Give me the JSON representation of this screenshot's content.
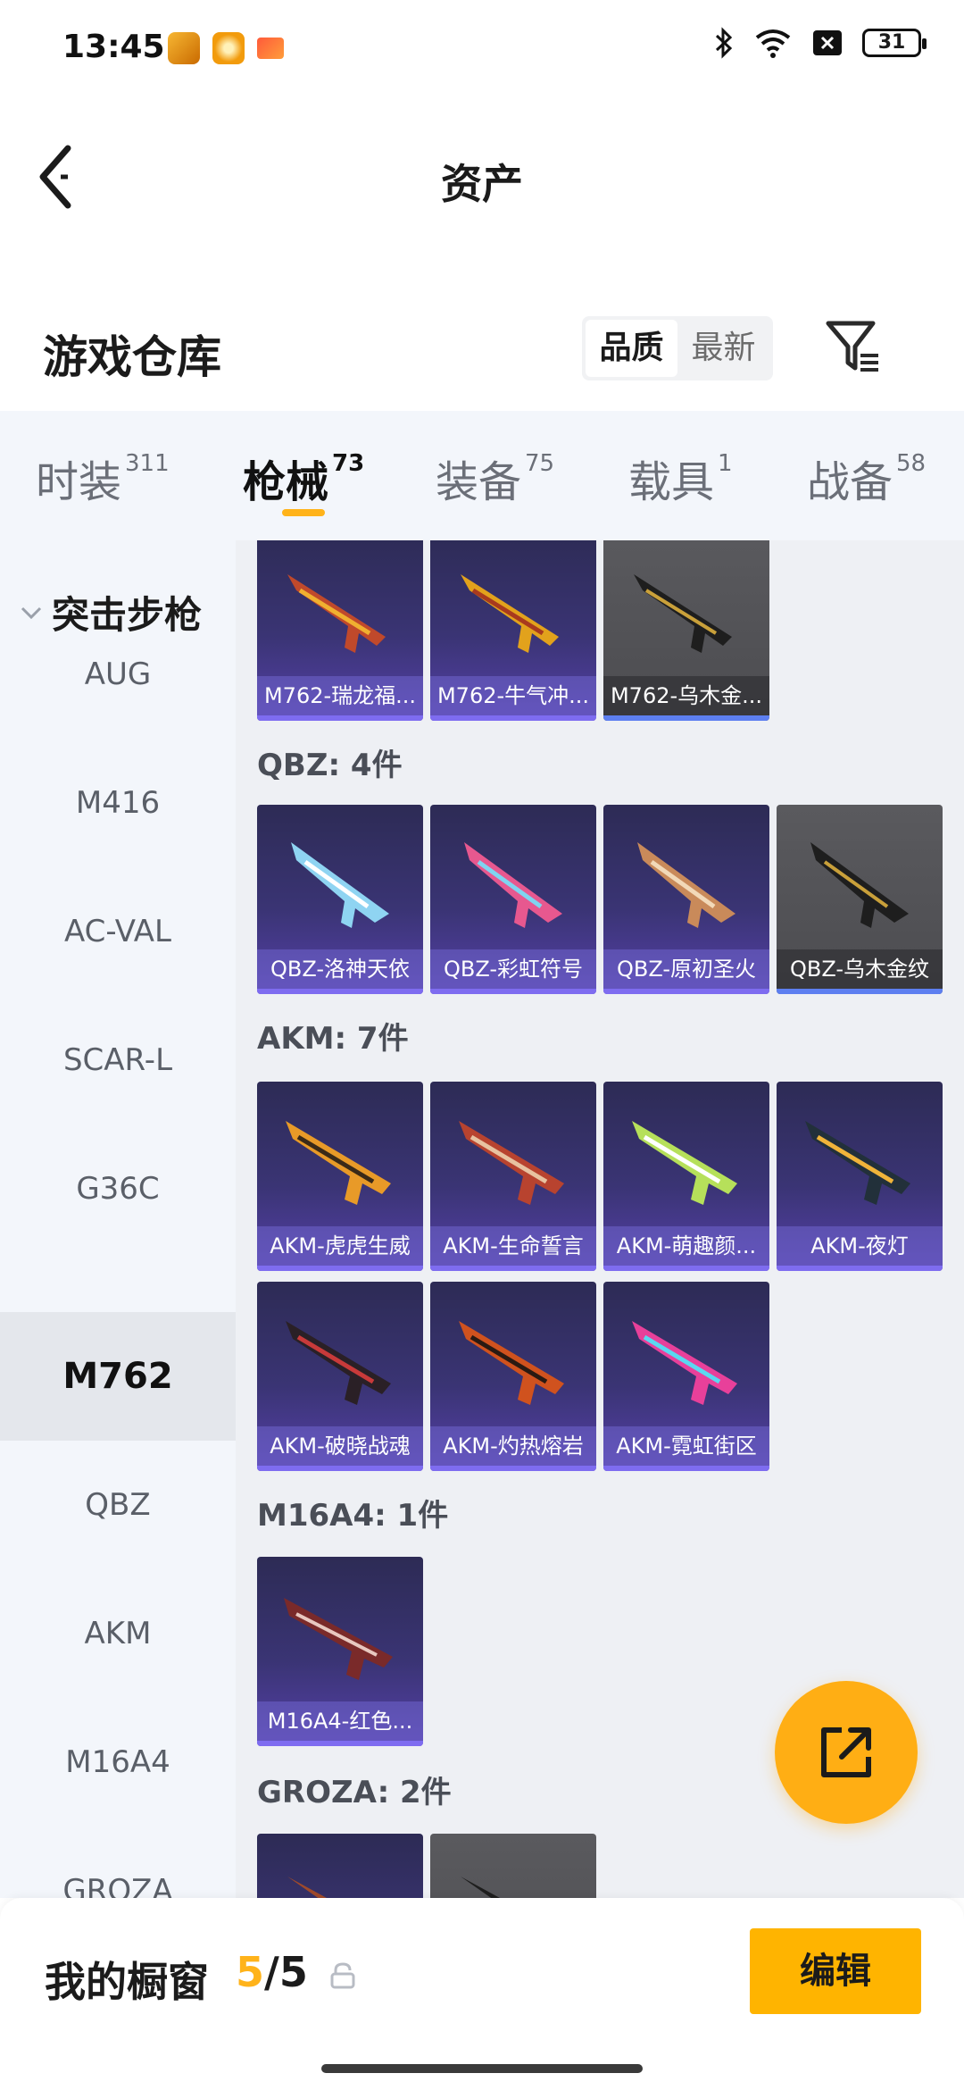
{
  "status_bar": {
    "time": "13:45",
    "battery": "31"
  },
  "header": {
    "title": "资产"
  },
  "warehouse": {
    "title": "游戏仓库",
    "sort_options": [
      "品质",
      "最新"
    ]
  },
  "tabs": [
    {
      "label": "时装",
      "count": "311"
    },
    {
      "label": "枪械",
      "count": "73"
    },
    {
      "label": "装备",
      "count": "75"
    },
    {
      "label": "载具",
      "count": "1"
    },
    {
      "label": "战备",
      "count": "58"
    }
  ],
  "sidebar": {
    "group": "突击步枪",
    "items": [
      "AUG",
      "M416",
      "AC-VAL",
      "SCAR-L",
      "G36C",
      "M762",
      "QBZ",
      "AKM",
      "M16A4",
      "GROZA"
    ]
  },
  "sections": [
    {
      "label": "",
      "items": [
        "M762-瑞龙福...",
        "M762-牛气冲...",
        "M762-乌木金..."
      ]
    },
    {
      "label": "QBZ: 4件",
      "items": [
        "QBZ-洛神天依",
        "QBZ-彩虹符号",
        "QBZ-原初圣火",
        "QBZ-乌木金纹"
      ]
    },
    {
      "label": "AKM: 7件",
      "items": [
        "AKM-虎虎生威",
        "AKM-生命誓言",
        "AKM-萌趣颜...",
        "AKM-夜灯",
        "AKM-破晓战魂",
        "AKM-灼热熔岩",
        "AKM-霓虹街区"
      ]
    },
    {
      "label": "M16A4: 1件",
      "items": [
        "M16A4-红色..."
      ]
    },
    {
      "label": "GROZA: 2件",
      "items": [
        "",
        ""
      ]
    }
  ],
  "bottom_bar": {
    "showcase_label": "我的橱窗",
    "showcase_current": "5",
    "showcase_total": "/5",
    "edit_label": "编辑"
  },
  "colors": {
    "accent": "#ffb31a",
    "card_bg": "#3a3474",
    "sidebar_bg": "#f3f6fb"
  }
}
